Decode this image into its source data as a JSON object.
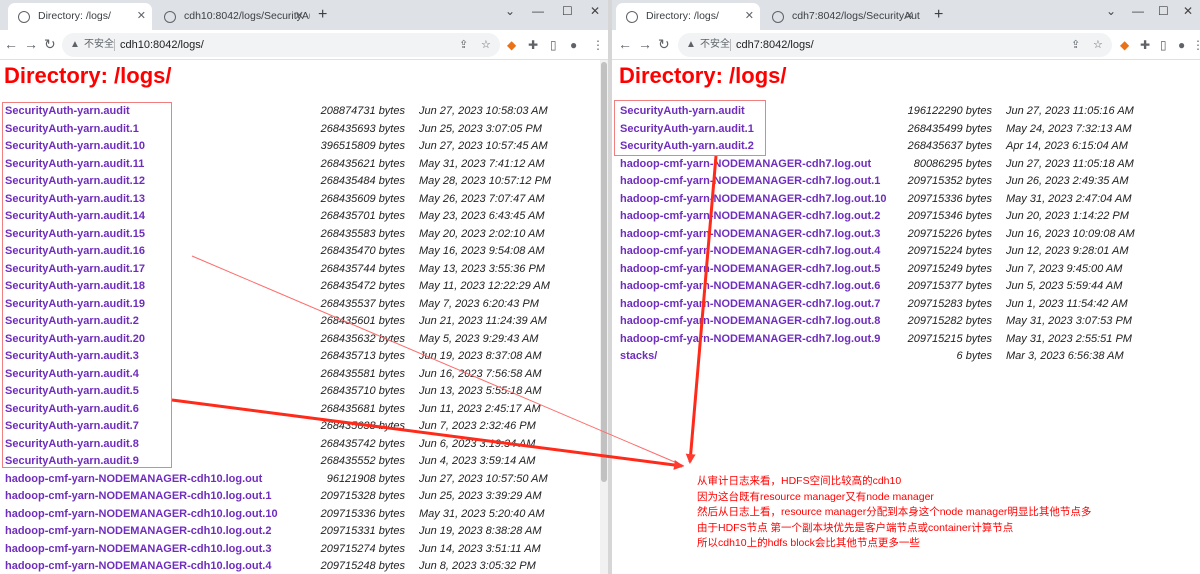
{
  "left": {
    "tabs": [
      {
        "title": "Directory: /logs/",
        "active": true
      },
      {
        "title": "cdh10:8042/logs/SecurityAuth",
        "active": false
      }
    ],
    "address": {
      "insecure_label": "不安全",
      "url": "cdh10:8042/logs/"
    },
    "heading": "Directory: /logs/",
    "files": [
      {
        "name": "SecurityAuth-yarn.audit",
        "size": "208874731 bytes",
        "date": "Jun 27, 2023 10:58:03 AM"
      },
      {
        "name": "SecurityAuth-yarn.audit.1",
        "size": "268435693 bytes",
        "date": "Jun 25, 2023 3:07:05 PM"
      },
      {
        "name": "SecurityAuth-yarn.audit.10",
        "size": "396515809 bytes",
        "date": "Jun 27, 2023 10:57:45 AM"
      },
      {
        "name": "SecurityAuth-yarn.audit.11",
        "size": "268435621 bytes",
        "date": "May 31, 2023 7:41:12 AM"
      },
      {
        "name": "SecurityAuth-yarn.audit.12",
        "size": "268435484 bytes",
        "date": "May 28, 2023 10:57:12 PM"
      },
      {
        "name": "SecurityAuth-yarn.audit.13",
        "size": "268435609 bytes",
        "date": "May 26, 2023 7:07:47 AM"
      },
      {
        "name": "SecurityAuth-yarn.audit.14",
        "size": "268435701 bytes",
        "date": "May 23, 2023 6:43:45 AM"
      },
      {
        "name": "SecurityAuth-yarn.audit.15",
        "size": "268435583 bytes",
        "date": "May 20, 2023 2:02:10 AM"
      },
      {
        "name": "SecurityAuth-yarn.audit.16",
        "size": "268435470 bytes",
        "date": "May 16, 2023 9:54:08 AM"
      },
      {
        "name": "SecurityAuth-yarn.audit.17",
        "size": "268435744 bytes",
        "date": "May 13, 2023 3:55:36 PM"
      },
      {
        "name": "SecurityAuth-yarn.audit.18",
        "size": "268435472 bytes",
        "date": "May 11, 2023 12:22:29 AM"
      },
      {
        "name": "SecurityAuth-yarn.audit.19",
        "size": "268435537 bytes",
        "date": "May 7, 2023 6:20:43 PM"
      },
      {
        "name": "SecurityAuth-yarn.audit.2",
        "size": "268435601 bytes",
        "date": "Jun 21, 2023 11:24:39 AM"
      },
      {
        "name": "SecurityAuth-yarn.audit.20",
        "size": "268435632 bytes",
        "date": "May 5, 2023 9:29:43 AM"
      },
      {
        "name": "SecurityAuth-yarn.audit.3",
        "size": "268435713 bytes",
        "date": "Jun 19, 2023 8:37:08 AM"
      },
      {
        "name": "SecurityAuth-yarn.audit.4",
        "size": "268435581 bytes",
        "date": "Jun 16, 2023 7:56:58 AM"
      },
      {
        "name": "SecurityAuth-yarn.audit.5",
        "size": "268435710 bytes",
        "date": "Jun 13, 2023 5:55:18 AM"
      },
      {
        "name": "SecurityAuth-yarn.audit.6",
        "size": "268435681 bytes",
        "date": "Jun 11, 2023 2:45:17 AM"
      },
      {
        "name": "SecurityAuth-yarn.audit.7",
        "size": "268435638 bytes",
        "date": "Jun 7, 2023 2:32:46 PM"
      },
      {
        "name": "SecurityAuth-yarn.audit.8",
        "size": "268435742 bytes",
        "date": "Jun 6, 2023 3:19:34 AM"
      },
      {
        "name": "SecurityAuth-yarn.audit.9",
        "size": "268435552 bytes",
        "date": "Jun 4, 2023 3:59:14 AM"
      },
      {
        "name": "hadoop-cmf-yarn-NODEMANAGER-cdh10.log.out",
        "size": "96121908 bytes",
        "date": "Jun 27, 2023 10:57:50 AM"
      },
      {
        "name": "hadoop-cmf-yarn-NODEMANAGER-cdh10.log.out.1",
        "size": "209715328 bytes",
        "date": "Jun 25, 2023 3:39:29 AM"
      },
      {
        "name": "hadoop-cmf-yarn-NODEMANAGER-cdh10.log.out.10",
        "size": "209715336 bytes",
        "date": "May 31, 2023 5:20:40 AM"
      },
      {
        "name": "hadoop-cmf-yarn-NODEMANAGER-cdh10.log.out.2",
        "size": "209715331 bytes",
        "date": "Jun 19, 2023 8:38:28 AM"
      },
      {
        "name": "hadoop-cmf-yarn-NODEMANAGER-cdh10.log.out.3",
        "size": "209715274 bytes",
        "date": "Jun 14, 2023 3:51:11 AM"
      },
      {
        "name": "hadoop-cmf-yarn-NODEMANAGER-cdh10.log.out.4",
        "size": "209715248 bytes",
        "date": "Jun 8, 2023 3:05:32 PM"
      }
    ]
  },
  "right": {
    "tabs": [
      {
        "title": "Directory: /logs/",
        "active": true
      },
      {
        "title": "cdh7:8042/logs/SecurityAuth-",
        "active": false
      }
    ],
    "address": {
      "insecure_label": "不安全",
      "url": "cdh7:8042/logs/"
    },
    "heading": "Directory: /logs/",
    "files": [
      {
        "name": "SecurityAuth-yarn.audit",
        "size": "196122290 bytes",
        "date": "Jun 27, 2023 11:05:16 AM"
      },
      {
        "name": "SecurityAuth-yarn.audit.1",
        "size": "268435499 bytes",
        "date": "May 24, 2023 7:32:13 AM"
      },
      {
        "name": "SecurityAuth-yarn.audit.2",
        "size": "268435637 bytes",
        "date": "Apr 14, 2023 6:15:04 AM"
      },
      {
        "name": "hadoop-cmf-yarn-NODEMANAGER-cdh7.log.out",
        "size": "80086295 bytes",
        "date": "Jun 27, 2023 11:05:18 AM"
      },
      {
        "name": "hadoop-cmf-yarn-NODEMANAGER-cdh7.log.out.1",
        "size": "209715352 bytes",
        "date": "Jun 26, 2023 2:49:35 AM"
      },
      {
        "name": "hadoop-cmf-yarn-NODEMANAGER-cdh7.log.out.10",
        "size": "209715336 bytes",
        "date": "May 31, 2023 2:47:04 AM"
      },
      {
        "name": "hadoop-cmf-yarn-NODEMANAGER-cdh7.log.out.2",
        "size": "209715346 bytes",
        "date": "Jun 20, 2023 1:14:22 PM"
      },
      {
        "name": "hadoop-cmf-yarn-NODEMANAGER-cdh7.log.out.3",
        "size": "209715226 bytes",
        "date": "Jun 16, 2023 10:09:08 AM"
      },
      {
        "name": "hadoop-cmf-yarn-NODEMANAGER-cdh7.log.out.4",
        "size": "209715224 bytes",
        "date": "Jun 12, 2023 9:28:01 AM"
      },
      {
        "name": "hadoop-cmf-yarn-NODEMANAGER-cdh7.log.out.5",
        "size": "209715249 bytes",
        "date": "Jun 7, 2023 9:45:00 AM"
      },
      {
        "name": "hadoop-cmf-yarn-NODEMANAGER-cdh7.log.out.6",
        "size": "209715377 bytes",
        "date": "Jun 5, 2023 5:59:44 AM"
      },
      {
        "name": "hadoop-cmf-yarn-NODEMANAGER-cdh7.log.out.7",
        "size": "209715283 bytes",
        "date": "Jun 1, 2023 11:54:42 AM"
      },
      {
        "name": "hadoop-cmf-yarn-NODEMANAGER-cdh7.log.out.8",
        "size": "209715282 bytes",
        "date": "May 31, 2023 3:07:53 PM"
      },
      {
        "name": "hadoop-cmf-yarn-NODEMANAGER-cdh7.log.out.9",
        "size": "209715215 bytes",
        "date": "May 31, 2023 2:55:51 PM"
      },
      {
        "name": "stacks/",
        "size": "6 bytes",
        "date": "Mar 3, 2023 6:56:38 AM"
      }
    ]
  },
  "annotation": {
    "lines": [
      "从审计日志来看，HDFS空间比较高的cdh10",
      "因为这台既有resource manager又有node manager",
      "然后从日志上看，resource manager分配到本身这个node manager明显比其他节点多",
      "由于HDFS节点 第一个副本块优先是客户端节点或container计算节点",
      "所以cdh10上的hdfs block会比其他节点更多一些"
    ],
    "color": "#ff0000"
  },
  "colors": {
    "link": "#6f2dbd",
    "heading": "#ff0000",
    "box": "#f08080"
  }
}
